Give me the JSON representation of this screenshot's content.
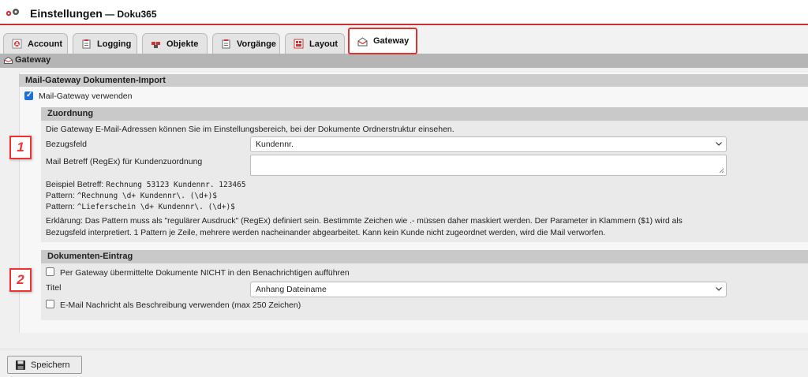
{
  "app": {
    "title": "Einstellungen",
    "separator": " — ",
    "subtitle": "Doku365"
  },
  "tabs": [
    {
      "label": "Account",
      "icon": "account-icon"
    },
    {
      "label": "Logging",
      "icon": "clipboard-icon"
    },
    {
      "label": "Objekte",
      "icon": "objects-icon"
    },
    {
      "label": "Vorgänge",
      "icon": "clipboard-icon"
    },
    {
      "label": "Layout",
      "icon": "layout-icon"
    },
    {
      "label": "Gateway",
      "icon": "mail-open-icon",
      "active": true
    }
  ],
  "section_bar": {
    "label": "Gateway"
  },
  "import_panel": {
    "header": "Mail-Gateway Dokumenten-Import",
    "use_gateway_label": "Mail-Gateway verwenden",
    "use_gateway_checked": true
  },
  "zuordnung": {
    "header": "Zuordnung",
    "info": "Die Gateway E-Mail-Adressen können Sie im Einstellungsbereich, bei der Dokumente Ordnerstruktur einsehen.",
    "bezugsfeld_label": "Bezugsfeld",
    "bezugsfeld_value": "Kundennr.",
    "betreff_label": "Mail Betreff (RegEx) für Kundenzuordnung",
    "betreff_value": "",
    "beispiel_prefix": "Beispiel Betreff: ",
    "beispiel_value": "Rechnung 53123 Kundennr. 123465",
    "pattern1_prefix": "Pattern: ",
    "pattern1_value": "^Rechnung \\d+ Kundennr\\. (\\d+)$",
    "pattern2_prefix": "Pattern: ",
    "pattern2_value": "^Lieferschein \\d+ Kundennr\\. (\\d+)$",
    "erklaerung_line1": "Erklärung: Das Pattern muss als \"regulärer Ausdruck\" (RegEx) definiert sein. Bestimmte Zeichen wie .- müssen daher maskiert werden. Der Parameter in Klammern ($1) wird als",
    "erklaerung_line2": "Bezugsfeld interpretiert. 1 Pattern je Zeile, mehrere werden nacheinander abgearbeitet. Kann kein Kunde nicht zugeordnet werden, wird die Mail verworfen."
  },
  "eintrag": {
    "header": "Dokumenten-Eintrag",
    "notify_label": "Per Gateway übermittelte Dokumente NICHT in den Benachrichtigen aufführen",
    "notify_checked": false,
    "titel_label": "Titel",
    "titel_value": "Anhang Dateiname",
    "mail_desc_label": "E-Mail Nachricht als Beschreibung verwenden (max 250 Zeichen)",
    "mail_desc_checked": false
  },
  "annotations": [
    "1",
    "2"
  ],
  "footer": {
    "save_label": "Speichern"
  },
  "colors": {
    "accent_red": "#d33333",
    "checkbox_blue": "#1e6fd9"
  }
}
